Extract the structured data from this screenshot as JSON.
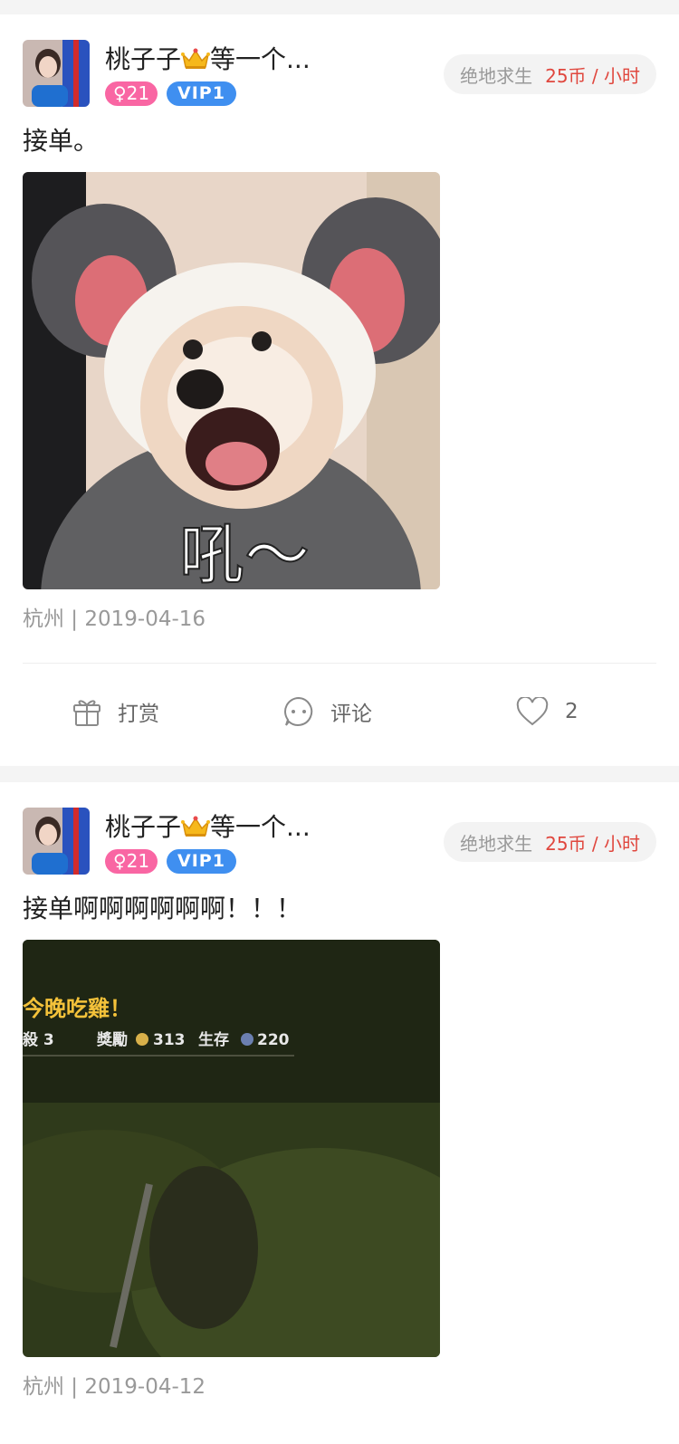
{
  "posts": [
    {
      "username": "桃子子",
      "username_suffix": "等一个...",
      "gender_badge": "♀21",
      "vip_badge": "VIP1",
      "game": "绝地求生",
      "price": "25币 / 小时",
      "text": "接单。",
      "image_caption": "吼～",
      "location_date": "杭州 | 2019-04-16",
      "actions": {
        "gift": "打赏",
        "comment": "评论",
        "likes": "2"
      }
    },
    {
      "username": "桃子子",
      "username_suffix": "等一个...",
      "gender_badge": "♀21",
      "vip_badge": "VIP1",
      "game": "绝地求生",
      "price": "25币 / 小时",
      "text": "接单啊啊啊啊啊啊！！！",
      "image_overlay": {
        "headline": "今晚吃雞！",
        "stats_left": "殺  3",
        "stats_mid_label": "獎勵",
        "stats_mid_value": "313",
        "stats_right_label": "生存",
        "stats_right_value": "220"
      },
      "location_date": "杭州 | 2019-04-12"
    }
  ],
  "colors": {
    "vip": "#3f8ff0",
    "gender": "#f966a3",
    "price": "#e0473e"
  }
}
